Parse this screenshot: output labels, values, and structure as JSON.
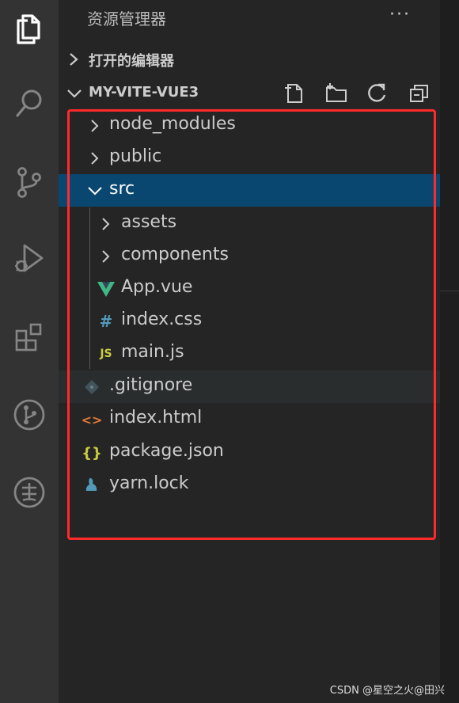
{
  "explorer": {
    "title": "资源管理器",
    "more": "···"
  },
  "sections": {
    "open_editors": "打开的编辑器",
    "project": "MY-VITE-VUE3"
  },
  "tree": [
    {
      "label": "node_modules",
      "type": "folder",
      "expanded": false,
      "depth": 0
    },
    {
      "label": "public",
      "type": "folder",
      "expanded": false,
      "depth": 0
    },
    {
      "label": "src",
      "type": "folder",
      "expanded": true,
      "depth": 0,
      "selected": true
    },
    {
      "label": "assets",
      "type": "folder",
      "expanded": false,
      "depth": 1
    },
    {
      "label": "components",
      "type": "folder",
      "expanded": false,
      "depth": 1
    },
    {
      "label": "App.vue",
      "type": "vue",
      "depth": 1
    },
    {
      "label": "index.css",
      "type": "css",
      "depth": 1
    },
    {
      "label": "main.js",
      "type": "js",
      "depth": 1
    },
    {
      "label": ".gitignore",
      "type": "git",
      "depth": 0
    },
    {
      "label": "index.html",
      "type": "html",
      "depth": 0
    },
    {
      "label": "package.json",
      "type": "json",
      "depth": 0
    },
    {
      "label": "yarn.lock",
      "type": "yarn",
      "depth": 0
    }
  ],
  "icons": {
    "css_glyph": "#",
    "js_glyph": "JS",
    "json_glyph": "{}",
    "html_glyph": "<>"
  },
  "colors": {
    "selection": "#094771",
    "highlight_box": "#ff2a2a",
    "vue": "#41b883",
    "css": "#519aba",
    "js": "#cbcb41",
    "html": "#e37933",
    "yarn": "#519aba"
  },
  "watermark": "CSDN @星空之火@田兴"
}
